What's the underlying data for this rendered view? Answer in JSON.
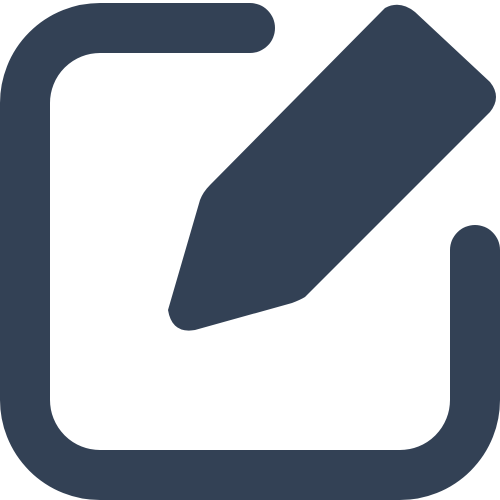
{
  "icon": {
    "name": "edit-icon",
    "color": "#334155"
  }
}
